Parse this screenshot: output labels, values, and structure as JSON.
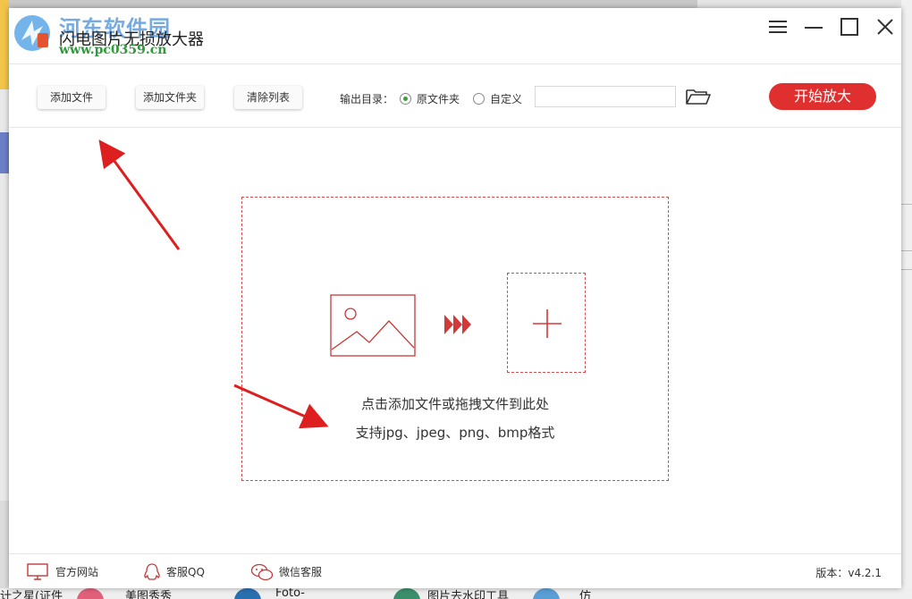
{
  "window": {
    "title": "闪电图片无损放大器",
    "watermark": "河东软件园",
    "watermark_url": "www.pc0359.cn"
  },
  "toolbar": {
    "add_file": "添加文件",
    "add_folder": "添加文件夹",
    "clear_list": "清除列表",
    "output_label": "输出目录：",
    "option_original": "原文件夹",
    "option_custom": "自定义",
    "output_path": "",
    "start": "开始放大"
  },
  "dropzone": {
    "hint_line1": "点击添加文件或拖拽文件到此处",
    "hint_line2": "支持jpg、jpeg、png、bmp格式"
  },
  "footer": {
    "website": "官方网站",
    "qq": "客服QQ",
    "wechat": "微信客服",
    "version": "版本：v4.2.1"
  },
  "background": {
    "bottom_items": [
      "计之星(证件",
      "美图秀秀",
      "Foto-",
      "图片去水印工具",
      "仿"
    ]
  },
  "colors": {
    "accent": "#e02f2f",
    "radio_selected": "#3aa039"
  },
  "icons": {
    "logo": "app-logo-icon",
    "minimize": "minimize-icon",
    "maximize": "maximize-icon",
    "close": "close-icon",
    "menu": "hamburger-menu-icon",
    "folder": "folder-open-icon",
    "image": "image-placeholder-icon",
    "arrows": "triple-arrow-icon",
    "plus": "plus-icon",
    "monitor": "monitor-icon",
    "qq": "qq-penguin-icon",
    "wechat": "wechat-icon"
  }
}
